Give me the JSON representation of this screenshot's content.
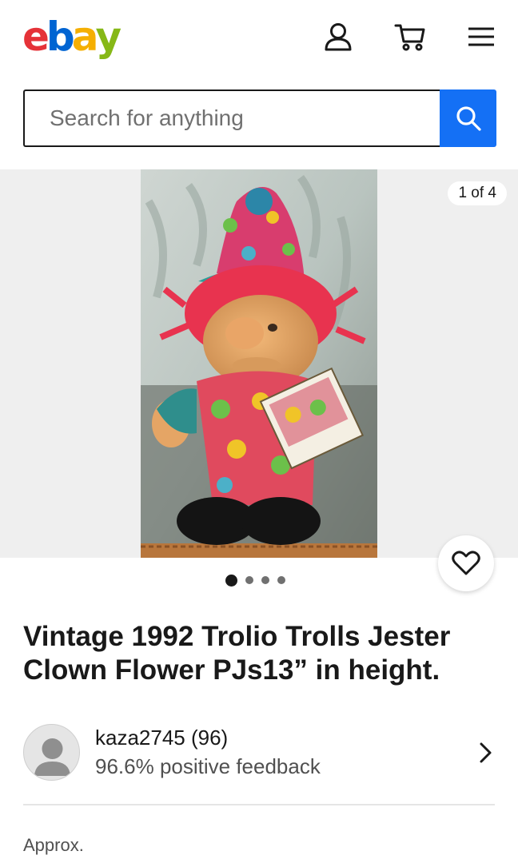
{
  "header": {
    "logo": {
      "letters": [
        "e",
        "b",
        "a",
        "y"
      ],
      "colors": [
        "#e53238",
        "#0064d2",
        "#f5af02",
        "#86b817"
      ]
    },
    "icons": [
      "account-icon",
      "cart-icon",
      "menu-icon"
    ]
  },
  "search": {
    "placeholder": "Search for anything",
    "value": "",
    "button_icon": "search-icon",
    "button_color": "#1470f5"
  },
  "gallery": {
    "counter": "1 of 4",
    "current_image": 1,
    "total_images": 4,
    "favorite_icon": "heart-icon"
  },
  "listing": {
    "title": "Vintage 1992 Trolio Trolls Jester Clown Flower PJs13” in height."
  },
  "seller": {
    "name_line": "kaza2745 (96)",
    "feedback": "96.6% positive feedback",
    "avatar_icon": "person-icon",
    "chevron_icon": "chevron-right-icon"
  },
  "price": {
    "label": "Approx."
  }
}
